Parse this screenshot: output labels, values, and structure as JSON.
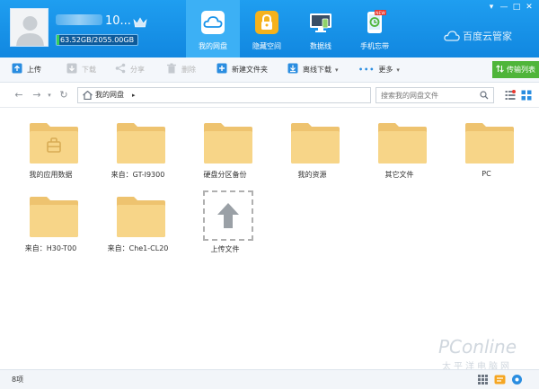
{
  "user": {
    "name_visible": "10...",
    "quota_text": "63.52GB/2055.00GB",
    "quota_fraction": 0.031
  },
  "nav_tabs": [
    {
      "label": "我的网盘",
      "icon": "cloud-icon",
      "active": true
    },
    {
      "label": "隐藏空间",
      "icon": "lock-icon",
      "active": false
    },
    {
      "label": "数据线",
      "icon": "monitor-icon",
      "active": false
    },
    {
      "label": "手机忘带",
      "icon": "phone-icon",
      "badge": "NEW",
      "active": false
    }
  ],
  "brand": "百度云管家",
  "window_buttons": [
    "▾",
    "—",
    "□",
    "✕"
  ],
  "toolbar": {
    "upload": "上传",
    "download": "下载",
    "share": "分享",
    "delete": "删除",
    "new_folder": "新建文件夹",
    "offline": "离线下载",
    "more": "更多",
    "transfer_list": "传输列表"
  },
  "address": {
    "path": "我的网盘",
    "search_placeholder": "搜索我的网盘文件"
  },
  "files": [
    {
      "name": "我的应用数据",
      "type": "app-folder"
    },
    {
      "name": "来自：GT-I9300",
      "type": "folder"
    },
    {
      "name": "硬盘分区备份",
      "type": "folder"
    },
    {
      "name": "我的资源",
      "type": "folder"
    },
    {
      "name": "其它文件",
      "type": "folder"
    },
    {
      "name": "PC",
      "type": "folder"
    },
    {
      "name": "来自：H30-T00",
      "type": "folder"
    },
    {
      "name": "来自：Che1-CL20",
      "type": "folder"
    },
    {
      "name": "上传文件",
      "type": "upload"
    }
  ],
  "status": {
    "count": "8项"
  },
  "colors": {
    "header_blue": "#1a94ea",
    "active_tab": "#3cb0f5",
    "folder": "#f7d588",
    "transfer_green": "#4fb53a"
  },
  "watermark": {
    "logo": "PConline",
    "text": "太平洋电脑网"
  }
}
